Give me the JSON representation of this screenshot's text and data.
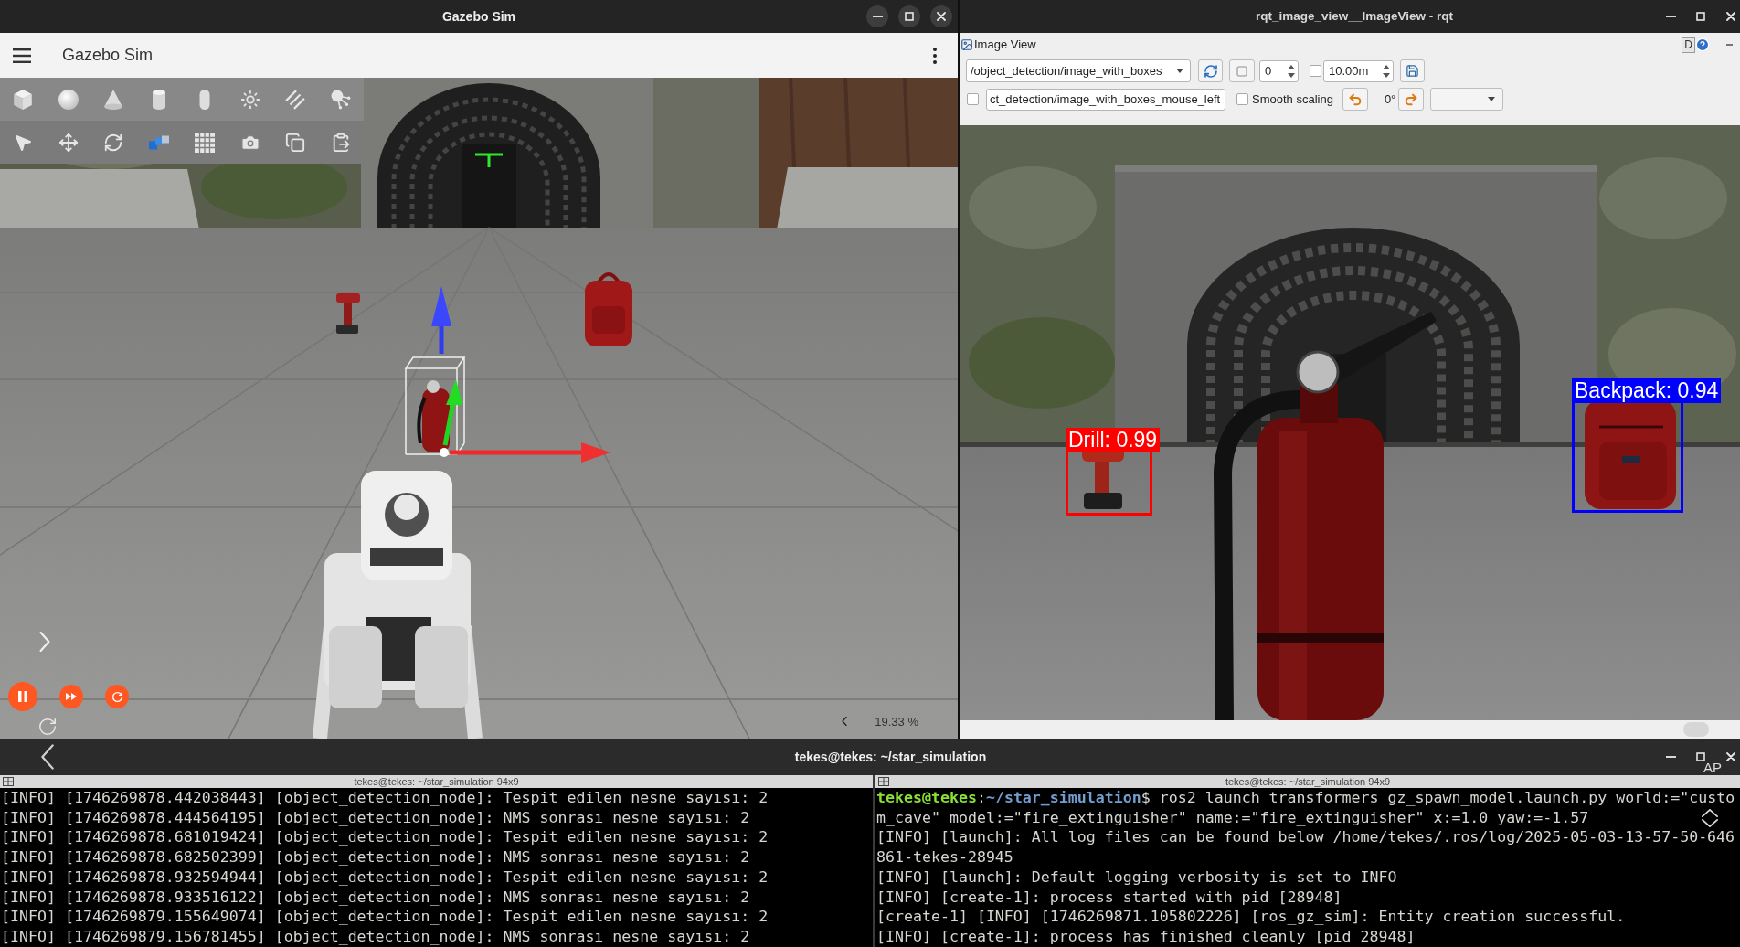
{
  "gazebo": {
    "window_title": "Gazebo Sim",
    "app_title": "Gazebo Sim",
    "running": true,
    "zoom_reading": "19.33 %"
  },
  "rqt": {
    "window_title": "rqt_image_view__ImageView - rqt",
    "plugin_title": "Image View",
    "dock_label": "D",
    "topic": "/object_detection/image_with_boxes",
    "number_field": "0",
    "range_checkbox": {
      "checked": false
    },
    "range_field": "10.00m",
    "click_checkbox": {
      "checked": false
    },
    "click_topic": "ct_detection/image_with_boxes_mouse_left",
    "smooth_scaling": {
      "label": "Smooth scaling",
      "checked": false
    },
    "rotation": "0°",
    "detections": [
      {
        "label": "Drill: 0.99",
        "color": "#ff0000"
      },
      {
        "label": "Backpack: 0.94",
        "color": "#0000ff"
      }
    ]
  },
  "terminal": {
    "window_title": "tekes@tekes: ~/star_simulation",
    "overlay_label": "AP",
    "panes": [
      {
        "title": "tekes@tekes: ~/star_simulation 94x9",
        "lines": [
          [
            {
              "kind": "plain",
              "text": "[INFO] [1746269878.442038443] [object_detection_node]: Tespit edilen nesne sayısı: 2"
            }
          ],
          [
            {
              "kind": "plain",
              "text": "[INFO] [1746269878.444564195] [object_detection_node]: NMS sonrası nesne sayısı: 2"
            }
          ],
          [
            {
              "kind": "plain",
              "text": "[INFO] [1746269878.681019424] [object_detection_node]: Tespit edilen nesne sayısı: 2"
            }
          ],
          [
            {
              "kind": "plain",
              "text": "[INFO] [1746269878.682502399] [object_detection_node]: NMS sonrası nesne sayısı: 2"
            }
          ],
          [
            {
              "kind": "plain",
              "text": "[INFO] [1746269878.932594944] [object_detection_node]: Tespit edilen nesne sayısı: 2"
            }
          ],
          [
            {
              "kind": "plain",
              "text": "[INFO] [1746269878.933516122] [object_detection_node]: NMS sonrası nesne sayısı: 2"
            }
          ],
          [
            {
              "kind": "plain",
              "text": "[INFO] [1746269879.155649074] [object_detection_node]: Tespit edilen nesne sayısı: 2"
            }
          ],
          [
            {
              "kind": "plain",
              "text": "[INFO] [1746269879.156781455] [object_detection_node]: NMS sonrası nesne sayısı: 2"
            }
          ]
        ]
      },
      {
        "title": "tekes@tekes: ~/star_simulation 94x9",
        "lines": [
          [
            {
              "kind": "user",
              "text": "tekes@tekes"
            },
            {
              "kind": "plain",
              "text": ":"
            },
            {
              "kind": "path",
              "text": "~/star_simulation"
            },
            {
              "kind": "plain",
              "text": "$ ros2 launch transformers gz_spawn_model.launch.py world:=\"custo"
            }
          ],
          [
            {
              "kind": "plain",
              "text": "m_cave\" model:=\"fire_extinguisher\" name:=\"fire_extinguisher\" x:=1.0 yaw:=-1.57"
            }
          ],
          [
            {
              "kind": "plain",
              "text": "[INFO] [launch]: All log files can be found below /home/tekes/.ros/log/2025-05-03-13-57-50-646"
            }
          ],
          [
            {
              "kind": "plain",
              "text": "861-tekes-28945"
            }
          ],
          [
            {
              "kind": "plain",
              "text": "[INFO] [launch]: Default logging verbosity is set to INFO"
            }
          ],
          [
            {
              "kind": "plain",
              "text": "[INFO] [create-1]: process started with pid [28948]"
            }
          ],
          [
            {
              "kind": "plain",
              "text": "[create-1] [INFO] [1746269871.105802226] [ros_gz_sim]: Entity creation successful."
            }
          ],
          [
            {
              "kind": "plain",
              "text": "[INFO] [create-1]: process has finished cleanly [pid 28948]"
            }
          ]
        ]
      }
    ]
  }
}
